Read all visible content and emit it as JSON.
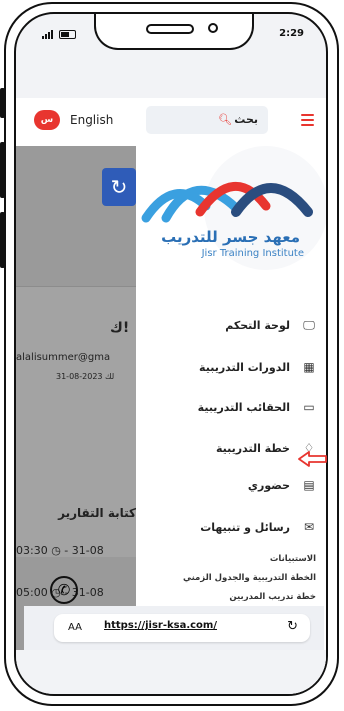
{
  "status": {
    "time": "2:29"
  },
  "header": {
    "lang_badge": "س",
    "lang_label": "English",
    "search_placeholder": "بحث"
  },
  "background": {
    "greeting": "ك!",
    "email": "alalisummer@gma",
    "date_line": "31-08-2023 لك",
    "heading": "كتابة التقارير",
    "time1": "03:30 ◷ - 31-08",
    "time2": "05:00 ◷ - 31-08"
  },
  "drawer": {
    "logo_ar": "معهد جسر للتدريب",
    "logo_en": "Jisr Training Institute",
    "brand_colors": [
      "#3aa0e0",
      "#e8352f",
      "#2a4d7f"
    ],
    "menu": [
      {
        "label": "لوحة التحكم",
        "icon": "monitor-icon"
      },
      {
        "label": "الدورات التدريبية",
        "icon": "building-icon"
      },
      {
        "label": "الحقائب التدريبية",
        "icon": "bag-icon"
      },
      {
        "label": "خطة التدريبية",
        "icon": "graduation-cap-icon"
      },
      {
        "label": "حضوري",
        "icon": "calendar-icon"
      },
      {
        "label": "رسائل و تنبيهات",
        "icon": "envelope-icon"
      }
    ],
    "submenu": [
      "الاستبيانات",
      "الخطة التدريبية والجدول الزمني",
      "خطة تدريب المدربين"
    ]
  },
  "urlbar": {
    "aa": "AA",
    "url": "https://jisr-ksa.com/"
  }
}
